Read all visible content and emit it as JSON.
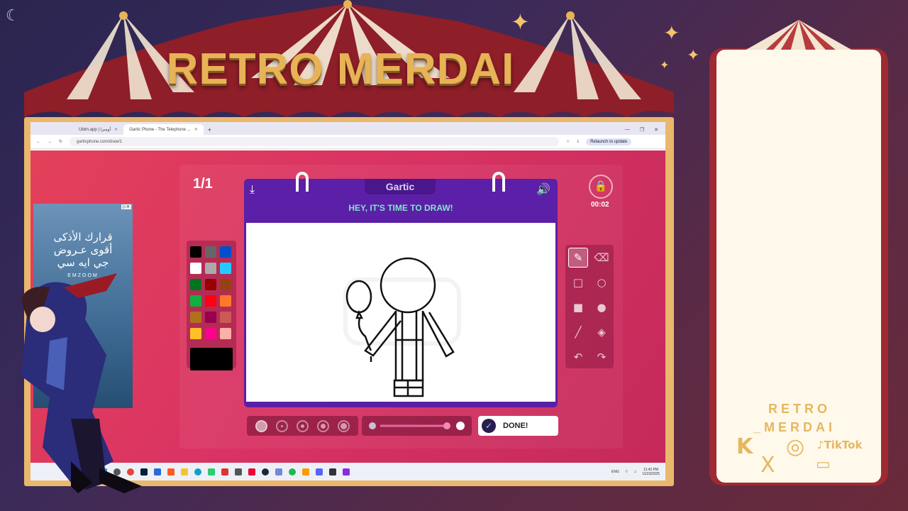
{
  "overlay": {
    "title": "RETRO MERDAI",
    "side_name_line1": "RETRO",
    "side_name_line2": "_MERDAI",
    "socials": {
      "kick": "K",
      "instagram": "◎",
      "tiktok": "♪TikTok",
      "x": "X",
      "twitch": "▭"
    }
  },
  "browser": {
    "tabs": [
      {
        "label": "Ubim.app | أومبرا",
        "active": false
      },
      {
        "label": "Gartic Phone - The Telephone ...",
        "active": true
      }
    ],
    "new_tab": "+",
    "window_controls": [
      "—",
      "❐",
      "✕"
    ],
    "nav": {
      "back": "←",
      "forward": "→",
      "reload": "↻"
    },
    "url": "garticphone.com/draw/1",
    "relaunch_label": "Relaunch to update"
  },
  "ad": {
    "line1": "قرارك الأذكى",
    "line2": "أقوى عـروض",
    "line3": "جي ايه سي",
    "brand": "EMZOOM",
    "choice": "▷✕"
  },
  "game": {
    "round_counter": "1/1",
    "logo": "Gartic",
    "message": "HEY, IT'S TIME TO DRAW!",
    "timer": "00:02",
    "download_icon": "⤓",
    "sound_icon": "🔊",
    "lock_icon": "🔒",
    "done_label": "DONE!",
    "done_icon": "✓",
    "colors": [
      "#000000",
      "#666666",
      "#0050cd",
      "#ffffff",
      "#aaaaaa",
      "#26c9ff",
      "#017420",
      "#990000",
      "#964112",
      "#11b03c",
      "#ff0013",
      "#ff7829",
      "#b0701c",
      "#99004e",
      "#cb5a57",
      "#ffc126",
      "#ff008f",
      "#feafa8"
    ],
    "selected_color": "#000000",
    "tools": [
      {
        "name": "pen",
        "glyph": "✎",
        "active": true
      },
      {
        "name": "eraser",
        "glyph": "⌫",
        "active": false
      },
      {
        "name": "rectangle-outline",
        "glyph": "□",
        "active": false
      },
      {
        "name": "ellipse-outline",
        "glyph": "○",
        "active": false
      },
      {
        "name": "rectangle-fill",
        "glyph": "■",
        "active": false
      },
      {
        "name": "ellipse-fill",
        "glyph": "●",
        "active": false
      },
      {
        "name": "line",
        "glyph": "╱",
        "active": false
      },
      {
        "name": "bucket",
        "glyph": "◈",
        "active": false
      },
      {
        "name": "undo",
        "glyph": "↶",
        "active": false
      },
      {
        "name": "redo",
        "glyph": "↷",
        "active": false
      }
    ],
    "brush_sizes_count": 5,
    "selected_brush": 0,
    "opacity_fraction": 1.0
  },
  "taskbar": {
    "lang": "ENG",
    "time": "11:42 PM",
    "date": "11/23/2025"
  }
}
